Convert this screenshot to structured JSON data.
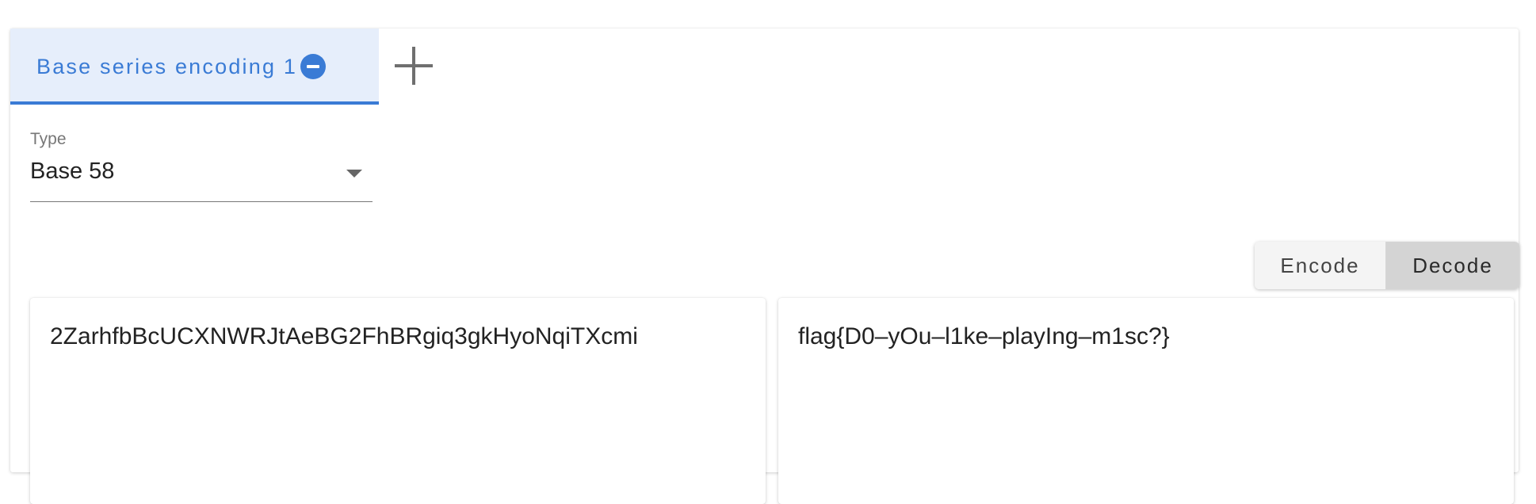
{
  "tabs": [
    {
      "label": "Base series encoding 1",
      "active": true
    }
  ],
  "add_tab_icon": "plus-icon",
  "close_tab_icon": "minus-circle-icon",
  "type_select": {
    "label": "Type",
    "value": "Base 58"
  },
  "mode_toggle": {
    "encode_label": "Encode",
    "decode_label": "Decode",
    "selected": "Decode"
  },
  "input_text": "2ZarhfbBcUCXNWRJtAeBG2FhBRgiq3gkHyoNqiTXcmi",
  "output_text": "flag{D0–yOu–l1ke–playIng–m1sc?}",
  "colors": {
    "accent": "#3a7bd5",
    "tab_background": "#e6eefb",
    "selected_toggle": "#d4d4d4"
  }
}
